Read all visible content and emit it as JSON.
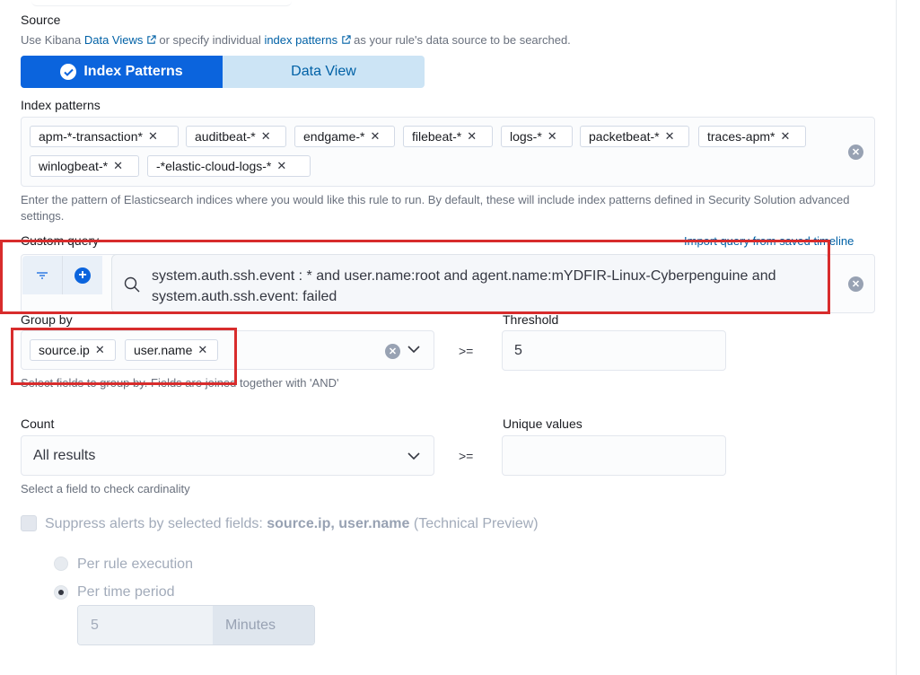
{
  "source": {
    "title": "Source",
    "help_prefix": "Use Kibana",
    "data_views_link": "Data Views",
    "help_middle": "or specify individual",
    "index_patterns_link": "index patterns",
    "help_suffix": "as your rule's data source to be searched."
  },
  "source_toggle": {
    "active_label": "Index Patterns",
    "inactive_label": "Data View"
  },
  "index_patterns": {
    "label": "Index patterns",
    "items": [
      "apm-*-transaction*",
      "auditbeat-*",
      "endgame-*",
      "filebeat-*",
      "logs-*",
      "packetbeat-*",
      "traces-apm*",
      "winlogbeat-*",
      "-*elastic-cloud-logs-*"
    ],
    "help": "Enter the pattern of Elasticsearch indices where you would like this rule to run. By default, these will include index patterns defined in Security Solution advanced settings."
  },
  "custom_query": {
    "label": "Custom query",
    "import_link": "Import query from saved timeline",
    "line1": "system.auth.ssh.event : * and user.name:root and agent.name:mYDFIR-Linux-Cyberpenguine and",
    "line2": "system.auth.ssh.event: failed"
  },
  "group_by": {
    "label": "Group by",
    "items": [
      "source.ip",
      "user.name"
    ],
    "help": "Select fields to group by. Fields are joined together with 'AND'"
  },
  "threshold": {
    "label": "Threshold",
    "operator": ">=",
    "value": "5"
  },
  "count": {
    "label": "Count",
    "value": "All results",
    "help": "Select a field to check cardinality"
  },
  "unique_values": {
    "label": "Unique values",
    "operator": ">=",
    "value": ""
  },
  "suppress": {
    "prefix": "Suppress alerts by selected fields:",
    "fields": "source.ip, user.name",
    "suffix": "(Technical Preview)",
    "options": [
      "Per rule execution",
      "Per time period"
    ],
    "selected": "Per time period",
    "duration_value": "5",
    "duration_unit": "Minutes"
  },
  "colors": {
    "primary": "#0b64dd",
    "link": "#0061a6",
    "annotation_red": "#d82c2c"
  }
}
